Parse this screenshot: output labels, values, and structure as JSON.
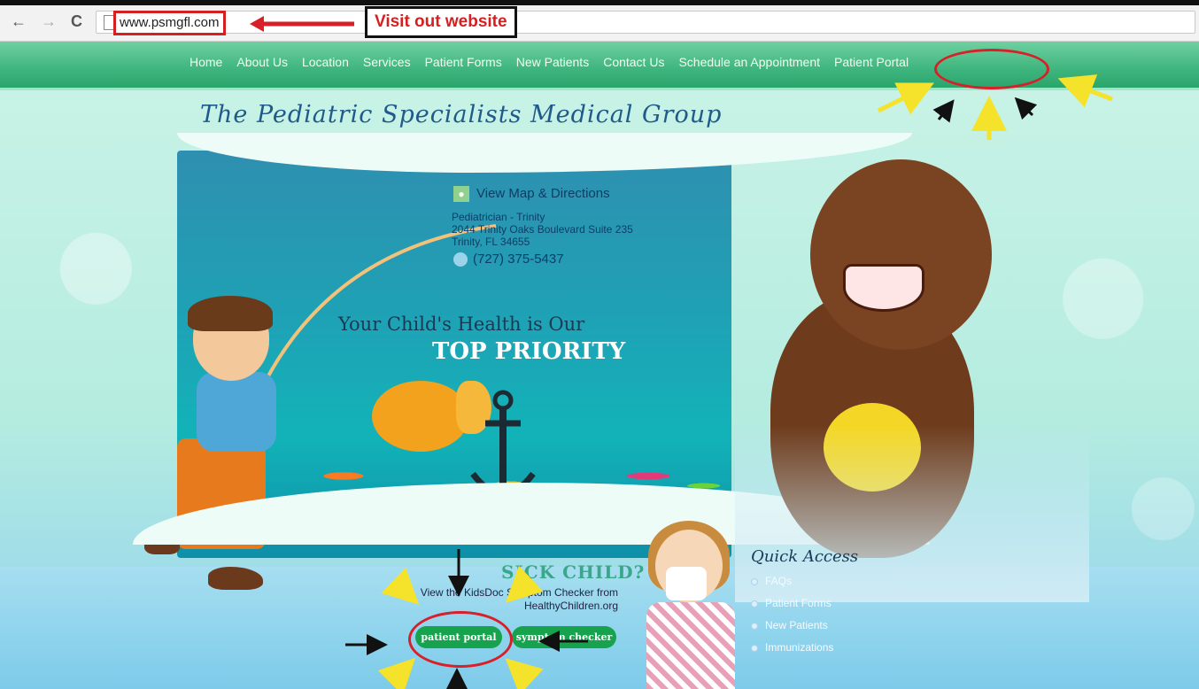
{
  "browser": {
    "back_icon": "back-arrow-icon",
    "back_glyph": "←",
    "forward_icon": "forward-arrow-icon",
    "forward_glyph": "→",
    "reload_icon": "reload-icon",
    "reload_glyph": "C",
    "url": "www.psmgfl.com"
  },
  "annotation": {
    "callout_text": "Visit out website",
    "highlight_color": "#d8202a",
    "arrow_colors": [
      "#111111",
      "#f5e22a"
    ]
  },
  "nav": {
    "items": [
      "Home",
      "About Us",
      "Location",
      "Services",
      "Patient Forms",
      "New Patients",
      "Contact Us",
      "Schedule an Appointment",
      "Patient Portal"
    ]
  },
  "site": {
    "title": "The Pediatric Specialists Medical Group",
    "map_link": "View Map & Directions",
    "address_line1": "Pediatrician - Trinity",
    "address_line2": "2044 Trinity Oaks Boulevard Suite 235",
    "address_line3": "Trinity, FL 34655",
    "phone": "(727) 375-5437",
    "tagline_line1": "Your Child's Health is Our",
    "tagline_line2": "TOP PRIORITY"
  },
  "sick_child": {
    "title": "SICK CHILD?",
    "text_line1": "View the KidsDoc Symptom Checker from",
    "text_line2": "HealthyChildren.org",
    "portal_button": "patient portal",
    "symptom_button": "symptom checker"
  },
  "quick_access": {
    "title": "Quick Access",
    "items": [
      "FAQs",
      "Patient Forms",
      "New Patients",
      "Immunizations"
    ]
  },
  "colors": {
    "nav_green": "#3fb57e",
    "button_green": "#17a24e",
    "background_mint": "#bfeee3"
  }
}
